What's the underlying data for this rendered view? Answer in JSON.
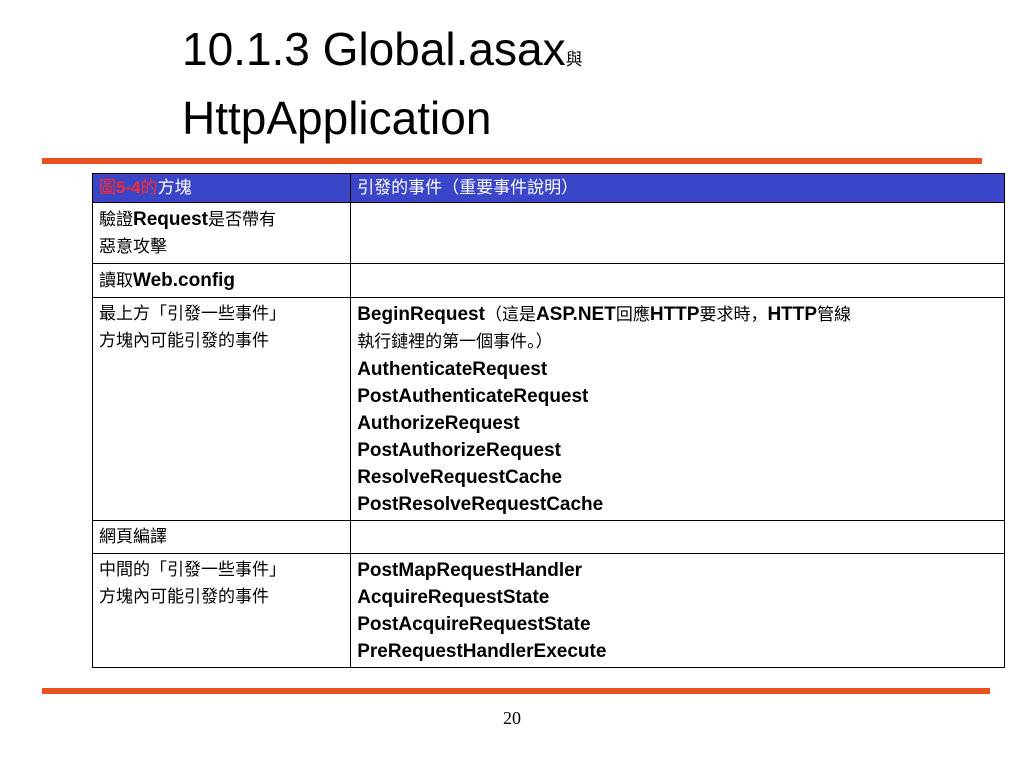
{
  "slide": {
    "title_line1_latin": "10.1.3   Global.asax",
    "title_line1_cjk": "與",
    "title_line2": "HttpApplication",
    "page_number": "20",
    "accent_color": "#e8501e"
  },
  "table": {
    "header": {
      "figure_label_prefix": "圖",
      "figure_label_number": "5-4",
      "figure_label_suffix": "的",
      "block_col": "方塊",
      "events_col": "引發的事件（重要事件說明）",
      "header_bg": "#3a45c8",
      "label_color": "#ff2a2a"
    },
    "rows": [
      {
        "block_parts": [
          {
            "t": "驗證",
            "latin": false
          },
          {
            "t": "Request",
            "latin": true
          },
          {
            "t": "是否帶有",
            "latin": false
          },
          {
            "t": "\n惡意攻擊",
            "latin": false
          }
        ],
        "events": []
      },
      {
        "block_parts": [
          {
            "t": "讀取",
            "latin": false
          },
          {
            "t": "Web.config",
            "latin": true
          }
        ],
        "events": []
      },
      {
        "block_parts": [
          {
            "t": "最上方「引發一些事件」\n方塊內可能引發的事件",
            "latin": false
          }
        ],
        "events_intro_parts": [
          {
            "t": "BeginRequest",
            "latin": true
          },
          {
            "t": "（這是",
            "latin": false
          },
          {
            "t": "ASP.NET",
            "latin": true
          },
          {
            "t": "回應",
            "latin": false
          },
          {
            "t": "HTTP",
            "latin": true
          },
          {
            "t": "要求時，",
            "latin": false
          },
          {
            "t": "HTTP",
            "latin": true
          },
          {
            "t": "管線\n執行鏈裡的第一個事件。）",
            "latin": false
          }
        ],
        "events": [
          "AuthenticateRequest",
          "PostAuthenticateRequest",
          "AuthorizeRequest",
          "PostAuthorizeRequest",
          "ResolveRequestCache",
          "PostResolveRequestCache"
        ]
      },
      {
        "block_parts": [
          {
            "t": "網頁編譯",
            "latin": false
          }
        ],
        "events": []
      },
      {
        "block_parts": [
          {
            "t": "中間的「引發一些事件」\n方塊內可能引發的事件",
            "latin": false
          }
        ],
        "events": [
          "PostMapRequestHandler",
          "AcquireRequestState",
          "PostAcquireRequestState",
          "PreRequestHandlerExecute"
        ]
      }
    ]
  }
}
